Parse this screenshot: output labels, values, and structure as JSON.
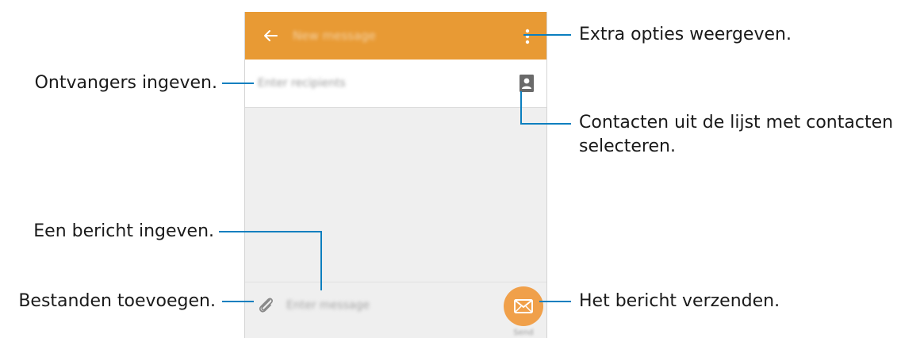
{
  "phone": {
    "appbar": {
      "title": "New message",
      "back_icon": "arrow-left-icon",
      "more_icon": "more-vertical-icon",
      "accent_color": "#e89a34"
    },
    "recipient_field": {
      "placeholder": "Enter recipients",
      "contact_icon": "contact-card-icon"
    },
    "compose": {
      "placeholder": "Enter message",
      "attach_icon": "paperclip-icon",
      "send_icon": "envelope-icon",
      "send_label": "Send"
    }
  },
  "callouts": {
    "more_options": "Extra opties weergeven.",
    "recipients": "Ontvangers ingeven.",
    "contacts_line1": "Contacten uit de lijst met contacten",
    "contacts_line2": "selecteren.",
    "message": "Een bericht ingeven.",
    "attach": "Bestanden toevoegen.",
    "send": "Het bericht verzenden."
  },
  "colors": {
    "callout_line": "#0b7fbf",
    "send_button": "#f0a04a"
  }
}
